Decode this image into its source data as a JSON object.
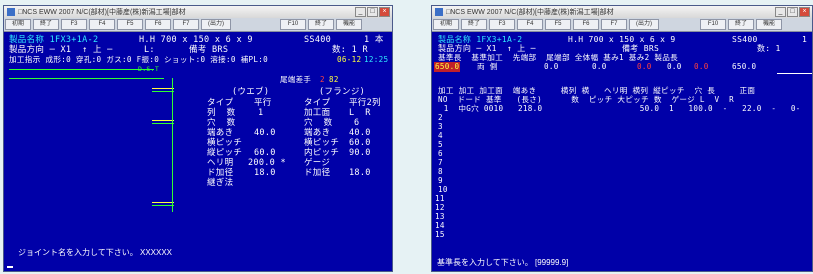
{
  "win1": {
    "title": "□NCS EWW 2007 N/C(部材)[中藤産(株)新潟工場]部材",
    "buttons": [
      "初期",
      "終了",
      "F3",
      "F4",
      "F5",
      "F6",
      "F7",
      "(出力)",
      "F10",
      "終了",
      "機能"
    ],
    "l1a": "製品名称 1FX3+1A-2",
    "l1b": "H.H 700 x 150 x 6 x 9",
    "l1c": "SS400",
    "l1d": "1 本",
    "l2a": "製品方向 ─ X1  ↑ 上 ─",
    "l2b": "L:",
    "l2c": "備考 BRS",
    "l2d": "数: 1 R",
    "l3": "加工指示 成形:0 穿孔:0 ガス:0 F振:0 ショット:0 溶接:0 補PL:0",
    "l3date": "06-12",
    "l3time": "12:25",
    "r1": "D.S.T",
    "flabel": "尾端差手",
    "fval": "82",
    "fnum": "2",
    "web": "(ウエブ)",
    "flange": "(フランジ)",
    "rows": [
      [
        "タイプ",
        "平行",
        "タイプ",
        "平行2列"
      ],
      [
        "列  数",
        "1",
        "加工面",
        "L  R"
      ],
      [
        "穴  数",
        "",
        "穴  数",
        "6"
      ],
      [
        "端あき",
        "40.0",
        "端あき",
        "40.0"
      ],
      [
        "横ピッチ",
        "",
        "横ピッチ",
        "60.0"
      ],
      [
        "縦ピッチ",
        "60.0",
        "内ピッチ",
        "90.0"
      ],
      [
        "ヘリ明",
        "200.0 *",
        "ゲージ",
        ""
      ],
      [
        "ド加径",
        "18.0",
        "ド加径",
        "18.0"
      ],
      [
        "継ぎ法",
        "",
        "",
        ""
      ]
    ],
    "prompt": "ジョイント名を入力して下さい。 XXXXXX"
  },
  "win2": {
    "title": "□NCS EWW 2007 N/C(部材)[中藤産(株)新潟工場]部材",
    "buttons": [
      "初期",
      "終了",
      "F3",
      "F4",
      "F5",
      "F6",
      "F7",
      "(出力)",
      "F10",
      "終了",
      "機能"
    ],
    "h1a": "製品名称 1FX3+1A-2",
    "h1b": "H.H 700 x 150 x 6 x 9",
    "h1c": "SS400",
    "h1d": "1",
    "h2a": "製品方向 ─ X1  ↑ 上 ─",
    "h2b": "備考 BRS",
    "h2c": "数: 1",
    "h3": "基準長  基準加工  先端部  尾端部 全体幅 基み1 基み2 製品長",
    "v1": "650.0",
    "v2": "両 側",
    "v3": "0.0",
    "v4": "0.0",
    "v5": "0.0",
    "v6": "0.0",
    "v7": "0.0",
    "v8": "650.0",
    "c1": "加工 加工 加工面  端あき     横列 横   ヘリ明 横列 縦ピッチ  穴 長     正面",
    "c2": "NO  ドード 基準   (長さ)      数  ピッチ 大ピッチ 数  ゲージ L  V  R",
    "r1": "  1  中G穴 0010   218.0                    50.0  1   100.0  -   22.0  -   0-",
    "rownums": [
      "1",
      "2",
      "3",
      "4",
      "5",
      "6",
      "7",
      "8",
      "9",
      "10",
      "11",
      "12",
      "13",
      "14",
      "15"
    ],
    "prompt": "基準長を入力して下さい。 [99999.9]"
  }
}
